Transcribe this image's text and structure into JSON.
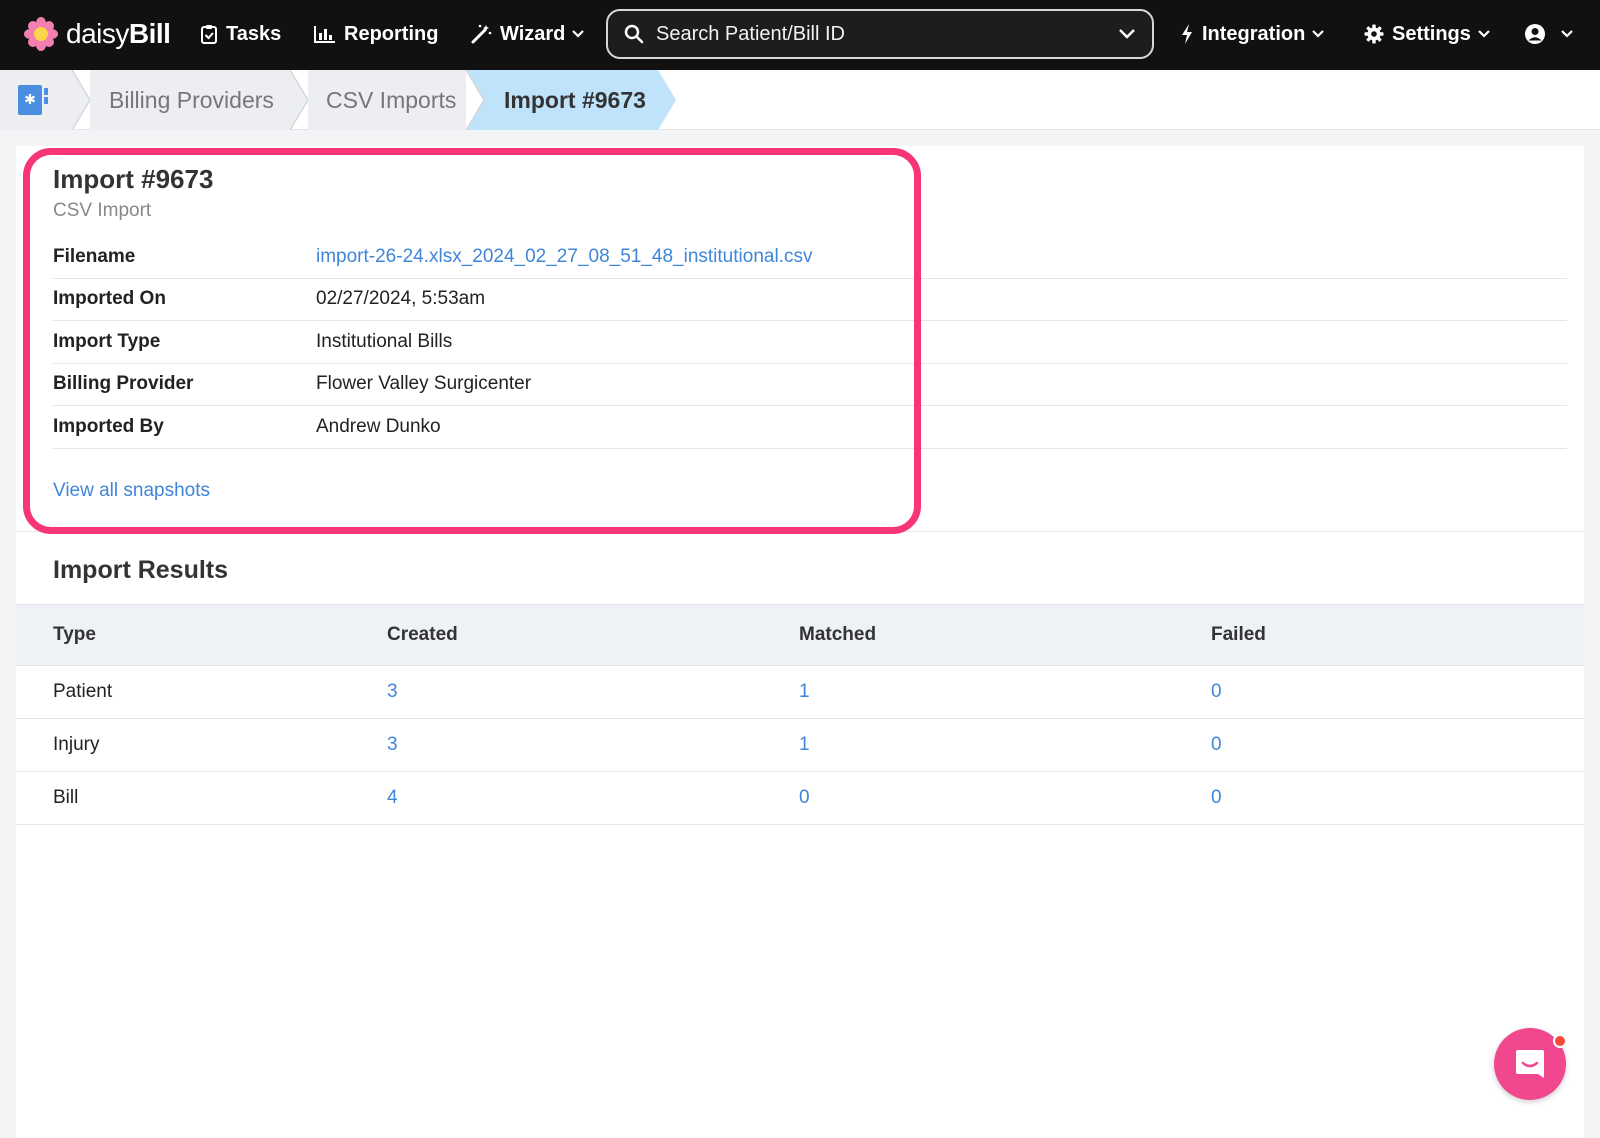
{
  "brand": {
    "name_light": "daisy",
    "name_bold": "Bill"
  },
  "nav": {
    "tasks": "Tasks",
    "reporting": "Reporting",
    "wizard": "Wizard",
    "integration": "Integration",
    "settings": "Settings"
  },
  "search": {
    "placeholder": "Search Patient/Bill ID"
  },
  "breadcrumb": {
    "items": [
      "Billing Providers",
      "CSV Imports",
      "Import #9673"
    ]
  },
  "import": {
    "title": "Import #9673",
    "subtitle": "CSV Import",
    "fields": [
      {
        "label": "Filename",
        "value": "import-26-24.xlsx_2024_02_27_08_51_48_institutional.csv"
      },
      {
        "label": "Imported On",
        "value": "02/27/2024, 5:53am"
      },
      {
        "label": "Import Type",
        "value": "Institutional Bills"
      },
      {
        "label": "Billing Provider",
        "value": "Flower Valley Surgicenter"
      },
      {
        "label": "Imported By",
        "value": "Andrew Dunko"
      }
    ],
    "snapshots_link": "View all snapshots"
  },
  "results": {
    "title": "Import Results",
    "columns": [
      "Type",
      "Created",
      "Matched",
      "Failed"
    ],
    "rows": [
      {
        "type": "Patient",
        "created": "3",
        "matched": "1",
        "failed": "0"
      },
      {
        "type": "Injury",
        "created": "3",
        "matched": "1",
        "failed": "0"
      },
      {
        "type": "Bill",
        "created": "4",
        "matched": "0",
        "failed": "0"
      }
    ]
  },
  "colors": {
    "nav_bg": "#111111",
    "link": "#3f86d8",
    "highlight": "#f73578",
    "breadcrumb_active": "#bfe3fb",
    "chat": "#f1478f"
  }
}
